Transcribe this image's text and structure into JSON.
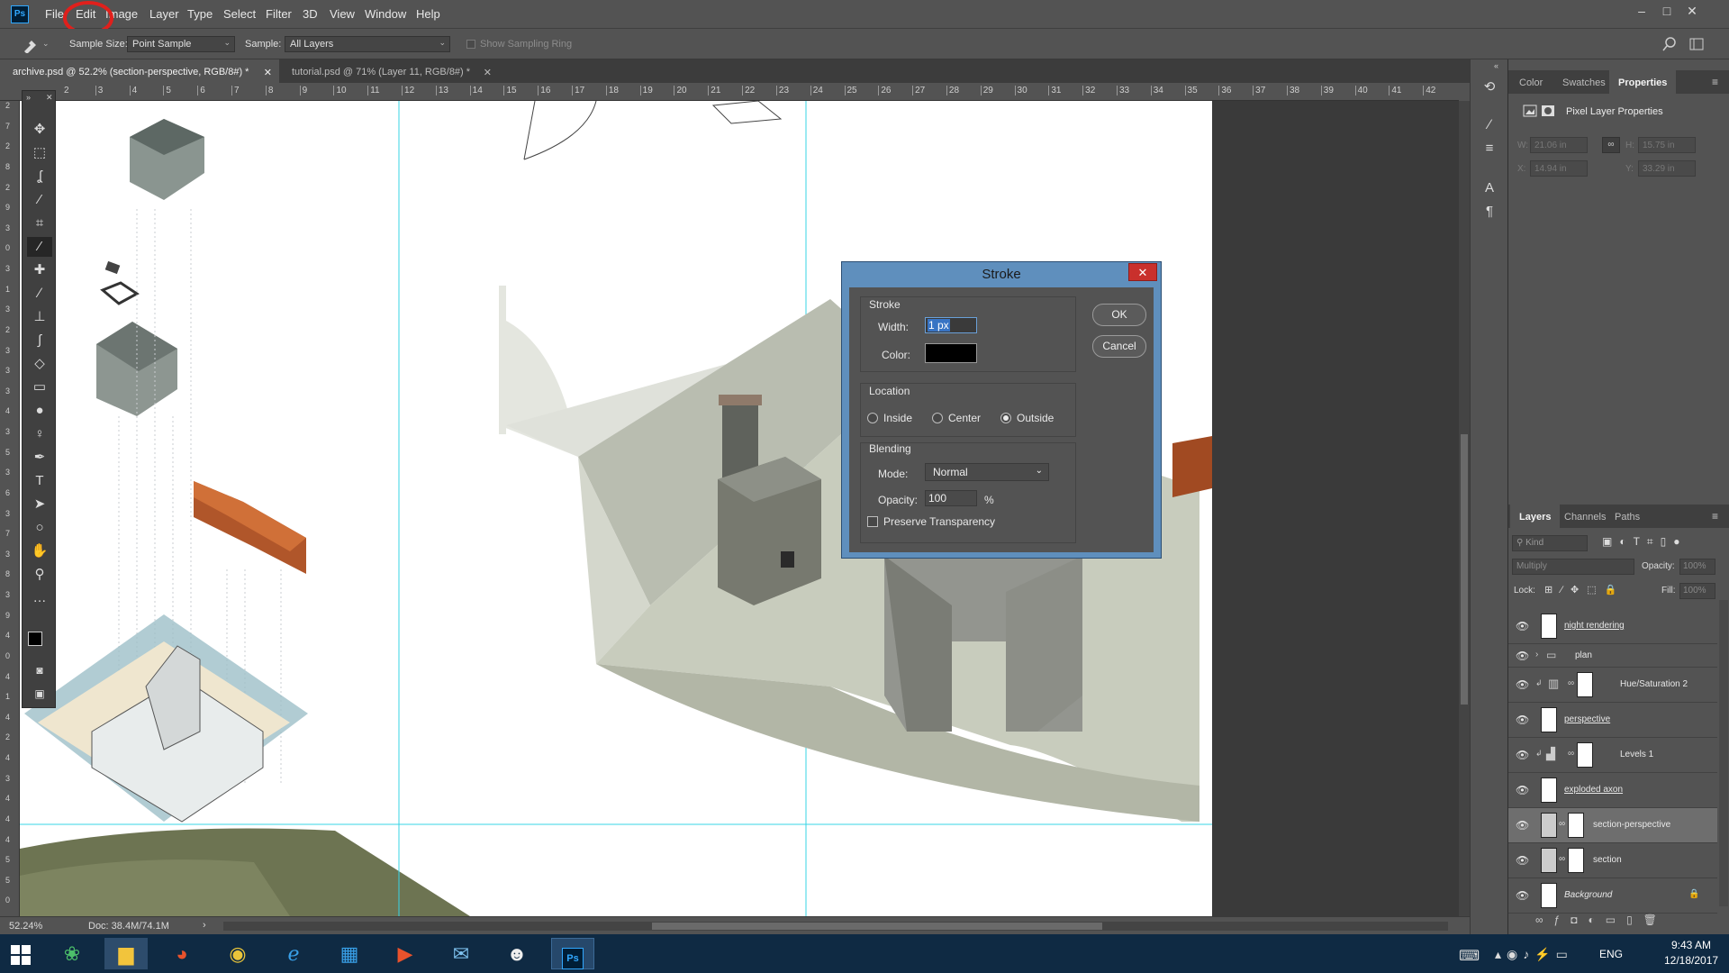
{
  "app": {
    "logo": "Ps"
  },
  "menu": [
    "File",
    "Edit",
    "Image",
    "Layer",
    "Type",
    "Select",
    "Filter",
    "3D",
    "View",
    "Window",
    "Help"
  ],
  "window_controls": {
    "minimize": "–",
    "maximize": "□",
    "close": "✕"
  },
  "options": {
    "sample_size_label": "Sample Size:",
    "sample_size_value": "Point Sample",
    "sample_label": "Sample:",
    "sample_value": "All Layers",
    "sampling_ring_label": "Show Sampling Ring"
  },
  "tabs": [
    {
      "label": "archive.psd @ 52.2% (section-perspective, RGB/8#) *",
      "close": "✕"
    },
    {
      "label": "tutorial.psd @ 71% (Layer 11, RGB/8#) *",
      "close": "✕"
    }
  ],
  "ruler_top": [
    "2",
    "3",
    "4",
    "5",
    "6",
    "7",
    "8",
    "9",
    "10",
    "11",
    "12",
    "13",
    "14",
    "15",
    "16",
    "17",
    "18",
    "19",
    "20",
    "21",
    "22",
    "23",
    "24",
    "25",
    "26",
    "27",
    "28",
    "29",
    "30",
    "31",
    "32",
    "33",
    "34",
    "35",
    "36",
    "37",
    "38",
    "39",
    "40",
    "41",
    "42"
  ],
  "ruler_left": [
    "2",
    "7",
    "2",
    "8",
    "2",
    "9",
    "3",
    "0",
    "3",
    "1",
    "3",
    "2",
    "3",
    "3",
    "3",
    "4",
    "3",
    "5",
    "3",
    "6",
    "3",
    "7",
    "3",
    "8",
    "3",
    "9",
    "4",
    "0",
    "4",
    "1",
    "4",
    "2",
    "4",
    "3",
    "4",
    "4",
    "4",
    "5",
    "5",
    "0"
  ],
  "status": {
    "zoom": "52.24%",
    "doc": "Doc: 38.4M/74.1M",
    "arrow": "›"
  },
  "panels": {
    "top_tabs": [
      "Color",
      "Swatches",
      "Properties"
    ],
    "properties_title": "Pixel Layer Properties",
    "w_label": "W:",
    "w_value": "21.06 in",
    "h_label": "H:",
    "h_value": "15.75 in",
    "x_label": "X:",
    "x_value": "14.94 in",
    "y_label": "Y:",
    "y_value": "33.29 in",
    "layer_tabs": [
      "Layers",
      "Channels",
      "Paths"
    ],
    "kind": "Kind",
    "blend_mode": "Multiply",
    "opacity_label": "Opacity:",
    "opacity_value": "100%",
    "lock_label": "Lock:",
    "fill_label": "Fill:",
    "fill_value": "100%"
  },
  "layers": [
    {
      "name": "night rendering",
      "type": "pixel"
    },
    {
      "name": "plan",
      "type": "group"
    },
    {
      "name": "Hue/Saturation 2",
      "type": "adjustment"
    },
    {
      "name": "perspective",
      "type": "pixel"
    },
    {
      "name": "Levels 1",
      "type": "adjustment"
    },
    {
      "name": "exploded axon",
      "type": "pixel"
    },
    {
      "name": "section-perspective",
      "type": "masked",
      "selected": true
    },
    {
      "name": "section",
      "type": "masked"
    },
    {
      "name": "Background",
      "type": "background"
    }
  ],
  "dialog": {
    "title": "Stroke",
    "close": "✕",
    "stroke_group": "Stroke",
    "width_label": "Width:",
    "width_value": "1 px",
    "color_label": "Color:",
    "stroke_color": "#000000",
    "ok": "OK",
    "cancel": "Cancel",
    "location_group": "Location",
    "loc_inside": "Inside",
    "loc_center": "Center",
    "loc_outside": "Outside",
    "location_selected": "Outside",
    "blending_group": "Blending",
    "mode_label": "Mode:",
    "mode_value": "Normal",
    "opacity_label": "Opacity:",
    "opacity_value": "100",
    "opacity_unit": "%",
    "preserve_label": "Preserve Transparency",
    "preserve_checked": false
  },
  "taskbar": {
    "language": "ENG",
    "time": "9:43 AM",
    "date": "12/18/2017",
    "apps": [
      "windows-start",
      "photo-app",
      "file-explorer",
      "media-app",
      "chrome",
      "internet-explorer",
      "app-grid",
      "player",
      "mail",
      "qq",
      "photoshop"
    ]
  },
  "colors": {
    "accent": "#37d4e6",
    "selection_circle": "#e0201c",
    "dialog_frame": "#5f8fbd"
  }
}
